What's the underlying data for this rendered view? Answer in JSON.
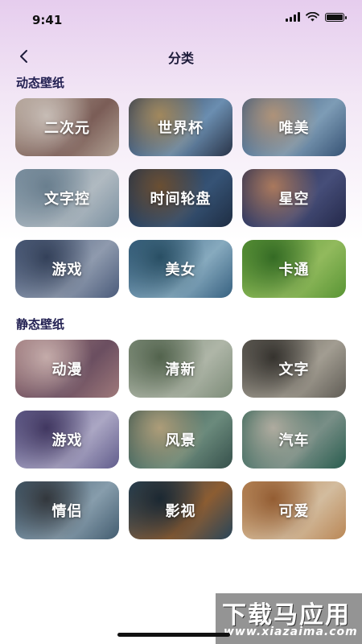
{
  "status_bar": {
    "time": "9:41"
  },
  "nav": {
    "title": "分类"
  },
  "sections": [
    {
      "title": "动态壁纸",
      "items": [
        {
          "label": "二次元",
          "colors": [
            "#c9b7a8",
            "#8c6a63",
            "#e3d7cf"
          ]
        },
        {
          "label": "世界杯",
          "colors": [
            "#2f3b52",
            "#7aa2c9",
            "#b89b6a"
          ]
        },
        {
          "label": "唯美",
          "colors": [
            "#3f5f86",
            "#8fb2cf",
            "#c7a78a"
          ]
        },
        {
          "label": "文字控",
          "colors": [
            "#8da5b8",
            "#c9d4dc",
            "#7890a2"
          ]
        },
        {
          "label": "时间轮盘",
          "colors": [
            "#23344d",
            "#3e5f86",
            "#7a5a3a"
          ]
        },
        {
          "label": "星空",
          "colors": [
            "#2a2f55",
            "#50598a",
            "#c28a6a"
          ]
        },
        {
          "label": "游戏",
          "colors": [
            "#55688c",
            "#a3b0c6",
            "#3b4a66"
          ]
        },
        {
          "label": "美女",
          "colors": [
            "#3f6f93",
            "#9ac2d9",
            "#2f5a72"
          ]
        },
        {
          "label": "卡通",
          "colors": [
            "#66aa3c",
            "#a6d46a",
            "#3c7a2a"
          ]
        }
      ]
    },
    {
      "title": "静态壁纸",
      "items": [
        {
          "label": "动漫",
          "colors": [
            "#b58a8c",
            "#7a5a6e",
            "#e0c4c2"
          ]
        },
        {
          "label": "清新",
          "colors": [
            "#8fa08a",
            "#c7cfbf",
            "#5e7158"
          ]
        },
        {
          "label": "文字",
          "colors": [
            "#6e6a62",
            "#b9b3a6",
            "#3d3a35"
          ]
        },
        {
          "label": "游戏",
          "colors": [
            "#6f6aa0",
            "#c3bedf",
            "#4a3f6e"
          ]
        },
        {
          "label": "风景",
          "colors": [
            "#3e5c56",
            "#7a9e8e",
            "#c6b38a"
          ]
        },
        {
          "label": "汽车",
          "colors": [
            "#2f6a5a",
            "#8aa39a",
            "#c8c4b6"
          ]
        },
        {
          "label": "情侣",
          "colors": [
            "#4d6a80",
            "#9ab3c4",
            "#3a3f45"
          ]
        },
        {
          "label": "影视",
          "colors": [
            "#2e4f66",
            "#a06a3a",
            "#1f2e3a"
          ]
        },
        {
          "label": "可爱",
          "colors": [
            "#d49a62",
            "#f0d6b4",
            "#a86a3a"
          ]
        }
      ]
    }
  ],
  "watermark": {
    "text": "下载马应用",
    "url": "www.xiazaima.com"
  }
}
